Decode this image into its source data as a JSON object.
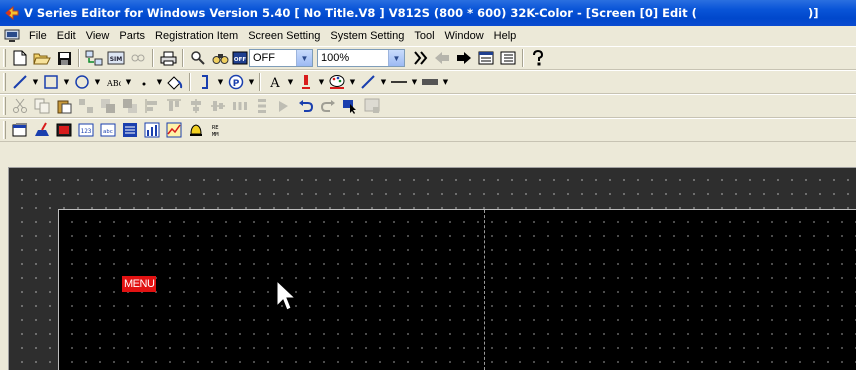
{
  "window": {
    "title": "V Series Editor for Windows Version 5.40 [ No Title.V8 ] V812S (800 * 600) 32K-Color - [Screen [0] Edit (",
    "title_tail": ")]"
  },
  "menubar": {
    "items": [
      "File",
      "Edit",
      "View",
      "Parts",
      "Registration Item",
      "Screen Setting",
      "System Setting",
      "Tool",
      "Window",
      "Help"
    ]
  },
  "toolbar1": {
    "display_combo": "OFF",
    "zoom_combo": "100%"
  },
  "canvas": {
    "menu_label": "MENU"
  },
  "colors": {
    "titlebar": "#0a55d8",
    "menu_label_bg": "#e21212",
    "screen_bg": "#000000",
    "workspace_bg": "#2e2e2e"
  },
  "icons": [
    "new-icon",
    "open-icon",
    "save-icon",
    "sim-icon",
    "print-icon",
    "zoom-icon",
    "help-icon",
    "line-icon",
    "rect-icon",
    "circle-icon",
    "text-icon",
    "paint-icon"
  ]
}
